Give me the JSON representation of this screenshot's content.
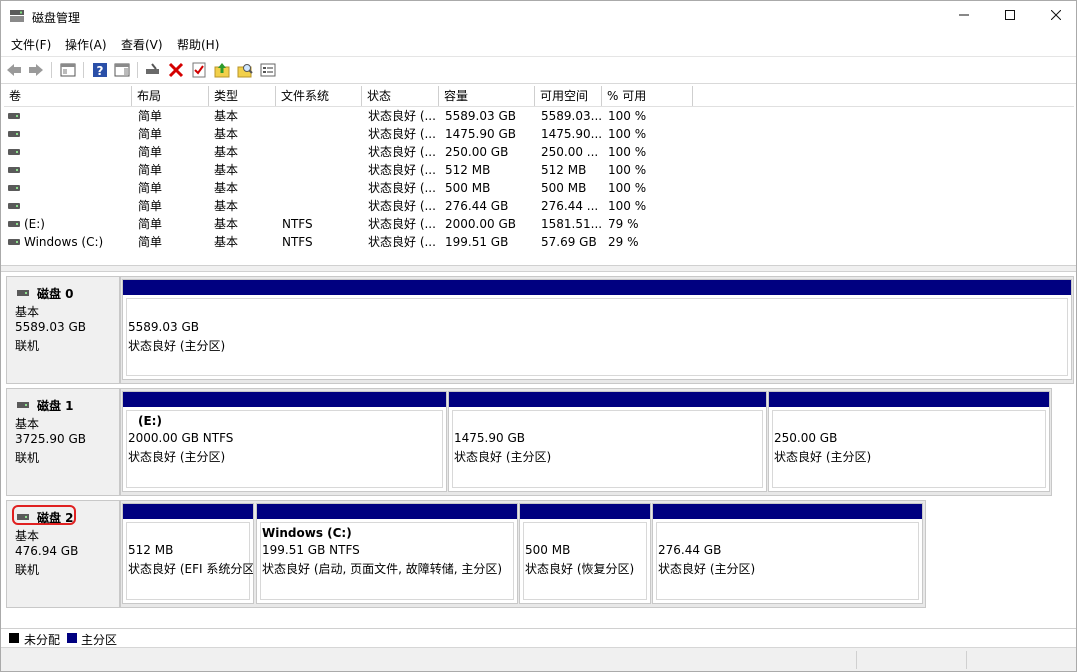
{
  "window": {
    "title": "磁盘管理"
  },
  "menu": [
    "文件(F)",
    "操作(A)",
    "查看(V)",
    "帮助(H)"
  ],
  "toolbar_icons": [
    "back-arrow-icon",
    "forward-arrow-icon",
    "console-tree-icon",
    "help-icon",
    "action-pane-icon",
    "connect-icon",
    "delete-icon",
    "check-icon",
    "upload-icon",
    "search-folder-icon",
    "properties-icon"
  ],
  "columns": [
    "卷",
    "布局",
    "类型",
    "文件系统",
    "状态",
    "容量",
    "可用空间",
    "% 可用"
  ],
  "volumes": [
    {
      "name": "",
      "layout": "简单",
      "type": "基本",
      "fs": "",
      "status": "状态良好 (...",
      "capacity": "5589.03 GB",
      "free": "5589.03...",
      "pct": "100 %"
    },
    {
      "name": "",
      "layout": "简单",
      "type": "基本",
      "fs": "",
      "status": "状态良好 (...",
      "capacity": "1475.90 GB",
      "free": "1475.90...",
      "pct": "100 %"
    },
    {
      "name": "",
      "layout": "简单",
      "type": "基本",
      "fs": "",
      "status": "状态良好 (...",
      "capacity": "250.00 GB",
      "free": "250.00 ...",
      "pct": "100 %"
    },
    {
      "name": "",
      "layout": "简单",
      "type": "基本",
      "fs": "",
      "status": "状态良好 (...",
      "capacity": "512 MB",
      "free": "512 MB",
      "pct": "100 %"
    },
    {
      "name": "",
      "layout": "简单",
      "type": "基本",
      "fs": "",
      "status": "状态良好 (...",
      "capacity": "500 MB",
      "free": "500 MB",
      "pct": "100 %"
    },
    {
      "name": "",
      "layout": "简单",
      "type": "基本",
      "fs": "",
      "status": "状态良好 (...",
      "capacity": "276.44 GB",
      "free": "276.44 ...",
      "pct": "100 %"
    },
    {
      "name": "(E:)",
      "layout": "简单",
      "type": "基本",
      "fs": "NTFS",
      "status": "状态良好 (...",
      "capacity": "2000.00 GB",
      "free": "1581.51...",
      "pct": "79 %"
    },
    {
      "name": "Windows (C:)",
      "layout": "简单",
      "type": "基本",
      "fs": "NTFS",
      "status": "状态良好 (...",
      "capacity": "199.51 GB",
      "free": "57.69 GB",
      "pct": "29 %"
    }
  ],
  "disks": [
    {
      "name": "磁盘 0",
      "type": "基本",
      "size": "5589.03 GB",
      "state": "联机",
      "partitions": [
        {
          "label": "",
          "size": "5589.03 GB",
          "status": "状态良好 (主分区)"
        }
      ]
    },
    {
      "name": "磁盘 1",
      "type": "基本",
      "size": "3725.90 GB",
      "state": "联机",
      "partitions": [
        {
          "label": "(E:)",
          "size": "2000.00 GB NTFS",
          "status": "状态良好 (主分区)"
        },
        {
          "label": "",
          "size": "1475.90 GB",
          "status": "状态良好 (主分区)"
        },
        {
          "label": "",
          "size": "250.00 GB",
          "status": "状态良好 (主分区)"
        }
      ]
    },
    {
      "name": "磁盘 2",
      "type": "基本",
      "size": "476.94 GB",
      "state": "联机",
      "partitions": [
        {
          "label": "",
          "size": "512 MB",
          "status": "状态良好 (EFI 系统分区)"
        },
        {
          "label": "Windows  (C:)",
          "size": "199.51 GB NTFS",
          "status": "状态良好 (启动, 页面文件, 故障转储, 主分区)"
        },
        {
          "label": "",
          "size": "500 MB",
          "status": "状态良好 (恢复分区)"
        },
        {
          "label": "",
          "size": "276.44 GB",
          "status": "状态良好 (主分区)"
        }
      ]
    }
  ],
  "legend": [
    {
      "label": "未分配",
      "color": "#000000"
    },
    {
      "label": "主分区",
      "color": "#000080"
    }
  ],
  "colors": {
    "partition_bar": "#000080",
    "highlight": "#e02020"
  }
}
